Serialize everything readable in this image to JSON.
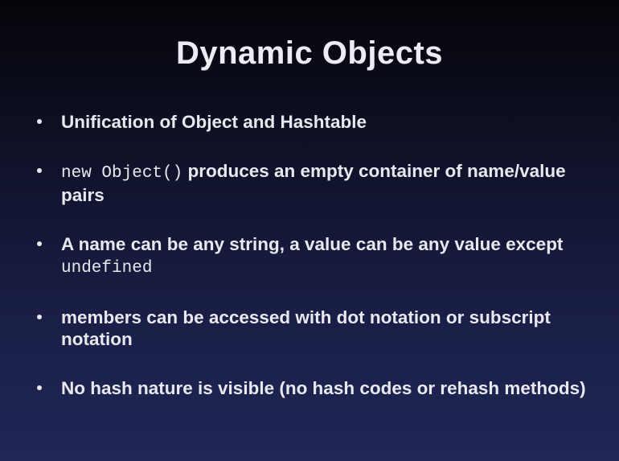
{
  "slide": {
    "title": "Dynamic Objects",
    "bullets": [
      {
        "parts": [
          {
            "text": "Unification of Object and Hashtable"
          }
        ]
      },
      {
        "parts": [
          {
            "code": "new Object()"
          },
          {
            "text": " produces an empty container of name/value pairs"
          }
        ]
      },
      {
        "parts": [
          {
            "text": "A name can be any string, a value can be any value except "
          },
          {
            "code": "undefined"
          }
        ]
      },
      {
        "parts": [
          {
            "text": "members can be accessed with dot notation or subscript notation"
          }
        ]
      },
      {
        "parts": [
          {
            "text": "No hash nature is visible (no hash codes or rehash methods)"
          }
        ]
      }
    ]
  }
}
